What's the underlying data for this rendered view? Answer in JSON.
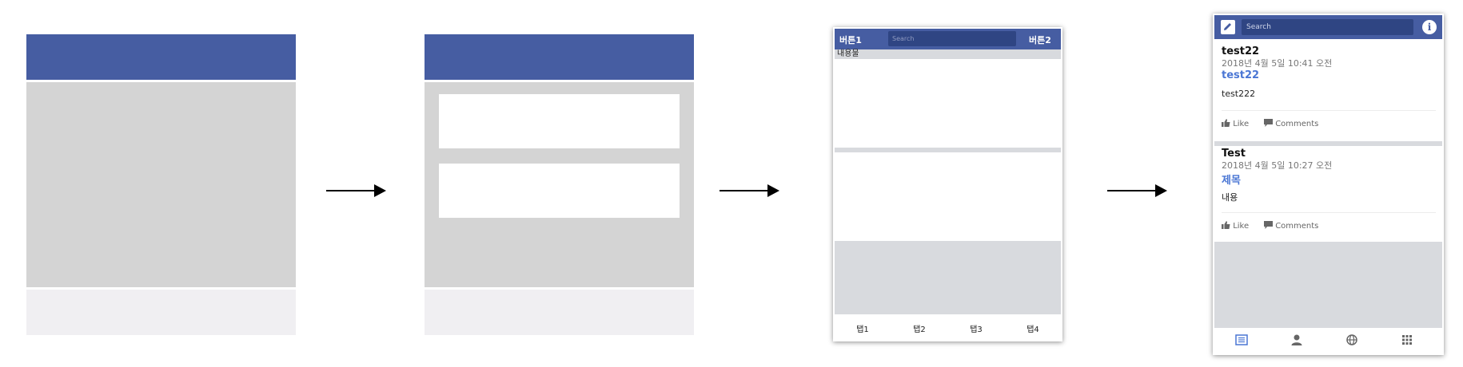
{
  "frame3": {
    "left_button": "버튼1",
    "right_button": "버튼2",
    "search_placeholder": "Search",
    "content_label": "내용물",
    "tabs": [
      "탭1",
      "탭2",
      "탭3",
      "탭4"
    ]
  },
  "frame4": {
    "search_placeholder": "Search",
    "posts": [
      {
        "author": "test22",
        "date": "2018년 4월 5일 10:41 오전",
        "title": "test22",
        "body": "test222"
      },
      {
        "author": "Test",
        "date": "2018년 4월 5일 10:27 오전",
        "title": "제목",
        "body": "내용"
      }
    ],
    "like_label": "Like",
    "comments_label": "Comments",
    "nav_icons": [
      "list-icon",
      "person-icon",
      "globe-icon",
      "grid-icon"
    ],
    "accent": "#4a76d4",
    "brand": "#465da2"
  }
}
